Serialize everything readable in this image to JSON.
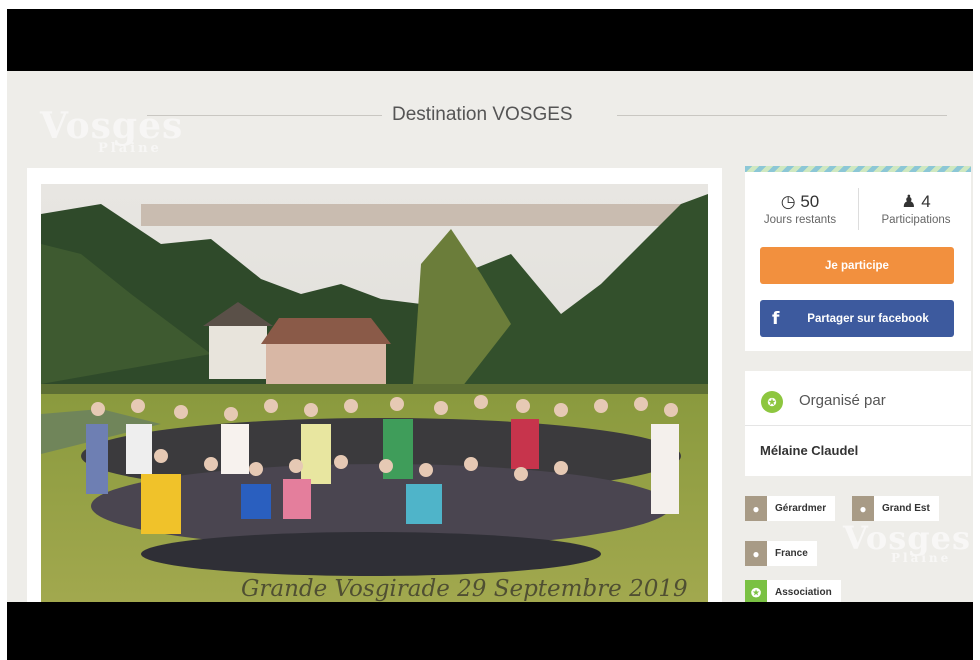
{
  "page_title": "Destination VOSGES",
  "watermark": {
    "brand": "Vosges",
    "sub": "Plaine"
  },
  "photo": {
    "caption": "Grande Vosgirade 29 Septembre 2019"
  },
  "stats": {
    "days_value": "50",
    "days_label": "Jours restants",
    "participants_value": "4",
    "participants_label": "Participations",
    "clock_icon": "⌚",
    "person_icon": "👤"
  },
  "buttons": {
    "participate": "Je participe",
    "share_facebook": "Partager sur facebook",
    "facebook_glyph": "f"
  },
  "organizer": {
    "heading": "Organisé par",
    "name": "Mélaine Claudel"
  },
  "tags": [
    {
      "label": "Gérardmer",
      "icon": "location-pin"
    },
    {
      "label": "Grand Est",
      "icon": "location-pin"
    },
    {
      "label": "France",
      "icon": "location-pin"
    },
    {
      "label": "Association",
      "icon": "ribbon"
    }
  ],
  "colors": {
    "accent_orange": "#f2903e",
    "facebook_blue": "#3d5a9e",
    "organizer_green": "#8dc63f",
    "tag_brown": "#a89b86",
    "background": "#eeede9"
  }
}
